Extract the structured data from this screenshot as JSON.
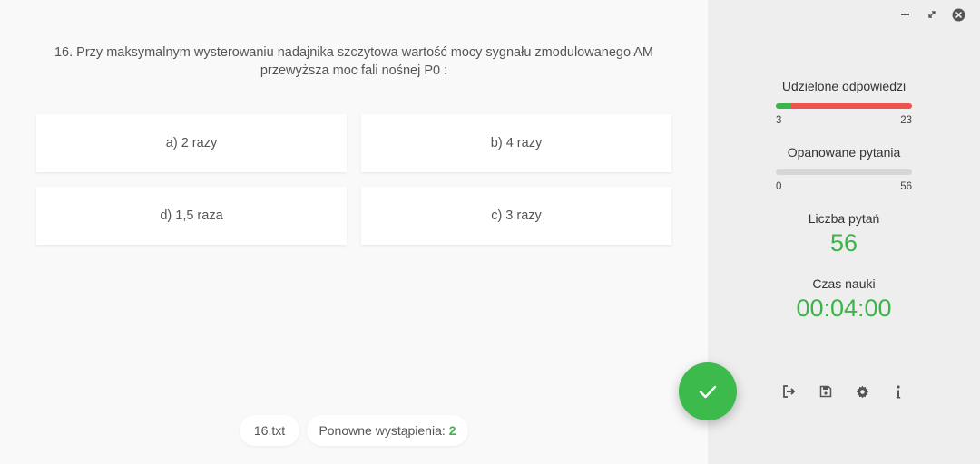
{
  "question": {
    "line1": "16. Przy maksymalnym wysterowaniu nadajnika szczytowa wartość mocy sygnału zmodulowanego AM",
    "line2": "przewyższa moc fali nośnej P0 :"
  },
  "answers": [
    {
      "label": "a) 2 razy"
    },
    {
      "label": "b) 4 razy"
    },
    {
      "label": "d) 1,5 raza"
    },
    {
      "label": "c) 3 razy"
    }
  ],
  "footer": {
    "file": "16.txt",
    "repeat_label": "Ponowne wystąpienia:",
    "repeat_count": "2"
  },
  "sidebar": {
    "answered": {
      "title": "Udzielone odpowiedzi",
      "correct": "3",
      "wrong": "23",
      "correct_fraction": 0.115
    },
    "mastered": {
      "title": "Opanowane pytania",
      "min": "0",
      "max": "56",
      "fraction": 0
    },
    "count": {
      "title": "Liczba pytań",
      "value": "56"
    },
    "time": {
      "title": "Czas nauki",
      "value": "00:04:00"
    }
  },
  "colors": {
    "accent_green": "#3bb54a",
    "wrong_red": "#ef5350"
  },
  "icons": [
    "minimize-icon",
    "restore-icon",
    "close-icon",
    "check-icon",
    "exit-icon",
    "save-icon",
    "gear-icon",
    "info-icon"
  ]
}
